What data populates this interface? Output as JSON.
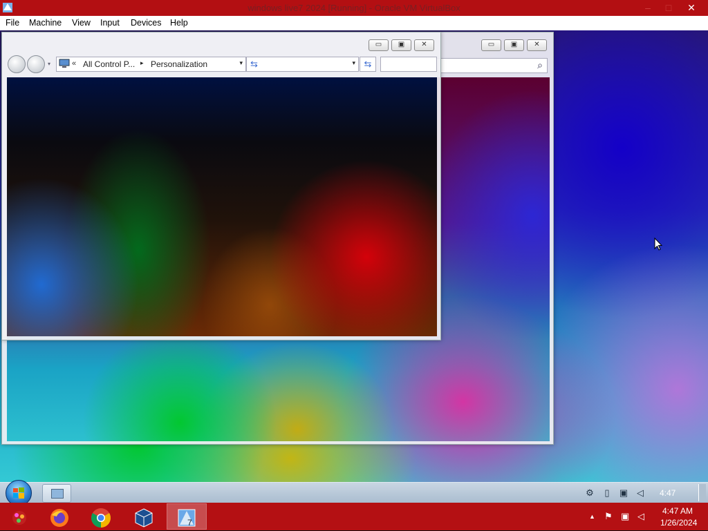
{
  "host_window": {
    "title": "windows live7 2024 [Running] - Oracle VM VirtualBox",
    "controls": {
      "minimize": "–",
      "restore": "□",
      "close": "✕"
    }
  },
  "menu": {
    "items": [
      "File",
      "Machine",
      "View",
      "Input",
      "Devices",
      "Help"
    ]
  },
  "explorer_front": {
    "breadcrumb": {
      "chevron": "«",
      "part1": "All Control P...",
      "separator": "▸",
      "part2": "Personalization"
    },
    "dropdown_arrow": "▾",
    "refresh_glyph": "⇆",
    "controls": {
      "minimize": "▭",
      "maximize": "▣",
      "close": "✕"
    }
  },
  "explorer_back": {
    "controls": {
      "minimize": "▭",
      "maximize": "▣",
      "close": "✕"
    },
    "search_glyph": "⌕"
  },
  "guest_taskbar": {
    "clock": "4:47",
    "tray_icons": [
      "network-icon",
      "document-icon",
      "monitor-icon",
      "volume-icon"
    ]
  },
  "host_taskbar": {
    "apps": [
      "flower-icon",
      "firefox-icon",
      "chrome-icon",
      "virtualbox-icon",
      "windows7-vm-icon"
    ],
    "tray_arrow": "▲",
    "clock_time": "4:47 AM",
    "clock_date": "1/26/2024"
  },
  "colors": {
    "host_red": "#b41013",
    "accent_blue": "#2a7fd0"
  }
}
